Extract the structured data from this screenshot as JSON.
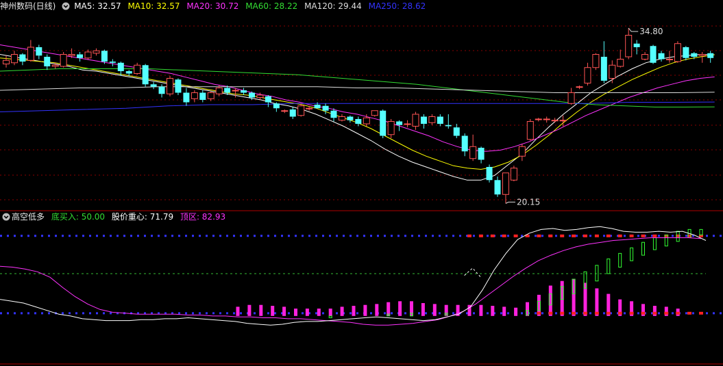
{
  "main_header": {
    "title": "神州数码(日线)",
    "icon": "circle-chevron-down-icon",
    "items": [
      {
        "text": "MA5: 32.57",
        "color": "#ffffff"
      },
      {
        "text": "MA10: 32.57",
        "color": "#ffff00"
      },
      {
        "text": "MA20: 30.72",
        "color": "#ff33ff"
      },
      {
        "text": "MA60: 28.22",
        "color": "#33dd33"
      },
      {
        "text": "MA120: 29.44",
        "color": "#dddddd"
      },
      {
        "text": "MA250: 28.62",
        "color": "#3333ff"
      }
    ]
  },
  "indicator_header": {
    "title": "高空低多",
    "icon": "circle-chevron-down-icon",
    "items": [
      {
        "text": "底买入: 50.00",
        "color": "#33dd33"
      },
      {
        "text": "股价重心: 71.79",
        "color": "#ffffff"
      },
      {
        "text": "顶区: 82.93",
        "color": "#ff33ff"
      }
    ]
  },
  "colors": {
    "up": "#ff5555",
    "down": "#55ffff",
    "grid": "#8b0000",
    "ma5": "#ffffff",
    "ma10": "#ffff00",
    "ma20": "#ff33ff",
    "ma60": "#33dd33",
    "ma120": "#dddddd",
    "ma250": "#3333ff"
  },
  "chart_data": [
    {
      "type": "candlestick",
      "title": "神州数码(日线)",
      "ylim": [
        20,
        36
      ],
      "high_label": "34.80",
      "low_label": "20.15",
      "candles": [
        [
          31.8,
          32.1,
          31.5,
          32.5
        ],
        [
          31.9,
          32.6,
          31.7,
          32.9
        ],
        [
          32.6,
          32.0,
          31.7,
          32.7
        ],
        [
          32.1,
          33.2,
          32.0,
          33.8
        ],
        [
          33.2,
          32.5,
          32.2,
          33.4
        ],
        [
          32.4,
          31.6,
          31.3,
          32.6
        ],
        [
          31.6,
          31.7,
          31.4,
          31.9
        ],
        [
          31.6,
          32.6,
          31.5,
          32.8
        ],
        [
          32.5,
          32.6,
          32.3,
          33.1
        ],
        [
          32.6,
          32.3,
          32.0,
          32.8
        ],
        [
          32.3,
          32.8,
          32.2,
          33.0
        ],
        [
          32.7,
          32.9,
          32.5,
          33.1
        ],
        [
          32.9,
          32.0,
          31.8,
          33.0
        ],
        [
          32.0,
          31.9,
          31.6,
          32.2
        ],
        [
          31.9,
          31.2,
          30.8,
          32.0
        ],
        [
          31.2,
          31.0,
          30.8,
          31.3
        ],
        [
          31.0,
          31.7,
          30.9,
          31.9
        ],
        [
          31.7,
          30.1,
          29.9,
          31.8
        ],
        [
          30.1,
          29.9,
          29.7,
          30.3
        ],
        [
          29.9,
          29.3,
          29.0,
          30.1
        ],
        [
          29.3,
          30.6,
          29.1,
          30.8
        ],
        [
          30.5,
          29.4,
          29.2,
          30.6
        ],
        [
          29.4,
          28.6,
          28.3,
          29.8
        ],
        [
          28.9,
          29.4,
          28.6,
          29.6
        ],
        [
          29.4,
          28.8,
          28.6,
          29.6
        ],
        [
          28.9,
          29.4,
          28.7,
          29.5
        ],
        [
          29.3,
          29.8,
          29.1,
          30.0
        ],
        [
          29.8,
          29.4,
          29.2,
          30.0
        ],
        [
          29.6,
          29.6,
          29.0,
          29.8
        ],
        [
          29.6,
          29.4,
          29.2,
          29.8
        ],
        [
          29.4,
          29.0,
          28.8,
          29.5
        ],
        [
          29.0,
          29.2,
          28.8,
          29.4
        ],
        [
          29.1,
          28.6,
          28.2,
          29.2
        ],
        [
          28.5,
          28.1,
          27.8,
          28.6
        ],
        [
          27.9,
          27.9,
          27.7,
          28.0
        ],
        [
          28.0,
          27.4,
          27.2,
          28.2
        ],
        [
          27.5,
          28.3,
          27.4,
          28.5
        ],
        [
          28.1,
          28.1,
          27.9,
          28.3
        ],
        [
          28.4,
          28.1,
          28.1,
          28.6
        ],
        [
          28.3,
          27.9,
          27.6,
          28.5
        ],
        [
          27.9,
          27.3,
          27.0,
          28.1
        ],
        [
          27.1,
          27.4,
          27.0,
          27.6
        ],
        [
          27.4,
          27.1,
          26.9,
          27.5
        ],
        [
          27.2,
          26.8,
          26.6,
          27.4
        ],
        [
          26.8,
          27.3,
          26.6,
          27.6
        ],
        [
          27.5,
          27.9,
          27.4,
          27.9
        ],
        [
          27.9,
          25.8,
          25.6,
          28.0
        ],
        [
          25.9,
          27.0,
          25.6,
          27.2
        ],
        [
          27.0,
          26.7,
          26.2,
          27.1
        ],
        [
          26.8,
          26.8,
          26.5,
          27.1
        ],
        [
          26.6,
          27.6,
          26.3,
          27.8
        ],
        [
          27.4,
          26.8,
          26.4,
          27.6
        ],
        [
          26.9,
          27.4,
          26.7,
          27.6
        ],
        [
          27.4,
          26.8,
          26.6,
          27.6
        ],
        [
          26.7,
          26.6,
          26.4,
          27.6
        ],
        [
          26.5,
          25.8,
          25.6,
          26.8
        ],
        [
          25.8,
          24.5,
          24.1,
          26.0
        ],
        [
          23.9,
          24.9,
          23.7,
          25.9
        ],
        [
          24.8,
          23.8,
          23.5,
          24.9
        ],
        [
          23.2,
          22.1,
          21.9,
          23.4
        ],
        [
          22.1,
          20.9,
          20.7,
          22.4
        ],
        [
          20.9,
          22.7,
          20.15,
          22.7
        ],
        [
          22.1,
          23.1,
          22.0,
          23.3
        ],
        [
          24.1,
          24.9,
          23.7,
          25.1
        ],
        [
          25.5,
          27.0,
          25.4,
          27.2
        ],
        [
          27.2,
          27.2,
          27.0,
          27.3
        ],
        [
          27.2,
          27.2,
          26.9,
          27.4
        ],
        [
          27.1,
          27.1,
          26.9,
          27.3
        ],
        [
          27.1,
          27.1,
          26.6,
          27.5
        ],
        [
          28.5,
          29.4,
          28.4,
          29.8
        ],
        [
          29.9,
          29.9,
          29.7,
          30.0
        ],
        [
          30.2,
          31.5,
          30.0,
          31.9
        ],
        [
          31.5,
          32.6,
          31.3,
          32.7
        ],
        [
          32.4,
          30.4,
          30.2,
          33.7
        ],
        [
          30.6,
          31.7,
          30.2,
          32.1
        ],
        [
          31.6,
          32.2,
          31.5,
          33.0
        ],
        [
          32.4,
          34.2,
          32.2,
          34.8
        ],
        [
          33.5,
          33.2,
          32.6,
          33.8
        ],
        [
          32.2,
          32.6,
          32.1,
          32.8
        ],
        [
          33.3,
          31.9,
          31.8,
          33.4
        ],
        [
          32.7,
          32.2,
          32.0,
          32.9
        ],
        [
          32.2,
          32.2,
          31.9,
          32.9
        ],
        [
          32.0,
          33.5,
          31.9,
          33.7
        ],
        [
          33.2,
          32.3,
          32.1,
          33.3
        ],
        [
          32.7,
          32.4,
          32.2,
          32.8
        ],
        [
          32.5,
          32.6,
          31.9,
          32.8
        ],
        [
          32.7,
          32.3,
          31.9,
          32.9
        ]
      ],
      "ma": {
        "ma5": [
          32.6,
          32.4,
          32.2,
          32.0,
          31.8,
          31.6,
          31.3,
          31.2,
          31.0,
          30.8,
          30.6,
          30.4,
          30.2,
          30.0,
          29.8,
          29.6,
          29.4,
          29.2,
          29.0,
          28.8,
          28.5,
          28.3,
          28.0,
          27.6,
          27.1,
          26.6,
          26.0,
          25.4,
          24.7,
          24.1,
          23.6,
          23.2,
          22.8,
          22.4,
          22.1,
          22.1,
          22.5,
          23.4,
          24.3,
          25.5,
          26.6,
          27.6,
          28.5,
          29.4,
          30.1,
          30.8,
          31.4,
          31.9,
          32.2,
          32.4,
          32.5,
          32.6,
          32.57
        ],
        "ma10": [
          32.3,
          32.2,
          32.1,
          32.0,
          31.9,
          31.7,
          31.5,
          31.3,
          31.1,
          30.9,
          30.7,
          30.5,
          30.3,
          30.1,
          29.9,
          29.7,
          29.5,
          29.3,
          29.2,
          29.0,
          28.8,
          28.6,
          28.4,
          28.1,
          27.7,
          27.3,
          26.9,
          26.4,
          25.8,
          25.2,
          24.6,
          24.1,
          23.7,
          23.3,
          23.1,
          23.0,
          23.2,
          23.6,
          24.2,
          25.0,
          25.9,
          26.9,
          27.8,
          28.6,
          29.3,
          29.9,
          30.5,
          31.0,
          31.5,
          31.9,
          32.2,
          32.4,
          32.57
        ],
        "ma20": [
          33.4,
          33.2,
          33.0,
          32.8,
          32.6,
          32.4,
          32.2,
          32.0,
          31.8,
          31.6,
          31.4,
          31.2,
          31.0,
          30.7,
          30.4,
          30.1,
          29.9,
          29.6,
          29.3,
          29.1,
          28.8,
          28.6,
          28.3,
          28.1,
          27.8,
          27.6,
          27.3,
          27.0,
          26.6,
          26.2,
          25.8,
          25.3,
          24.9,
          24.6,
          24.5,
          24.6,
          24.9,
          25.3,
          25.8,
          26.3,
          26.9,
          27.5,
          28.0,
          28.5,
          29.0,
          29.4,
          29.8,
          30.1,
          30.4,
          30.6,
          30.72
        ],
        "ma60": [
          31.2,
          31.3,
          31.4,
          31.4,
          31.4,
          31.4,
          31.3,
          31.2,
          31.1,
          31.0,
          30.9,
          30.7,
          30.5,
          30.3,
          30.1,
          29.8,
          29.5,
          29.2,
          28.9,
          28.6,
          28.4,
          28.3,
          28.2,
          28.2,
          28.22
        ],
        "ma120": [
          29.6,
          29.7,
          29.8,
          29.8,
          29.9,
          29.9,
          29.9,
          29.9,
          29.9,
          29.8,
          29.8,
          29.7,
          29.6,
          29.5,
          29.4,
          29.4,
          29.4,
          29.4,
          29.44
        ],
        "ma250": [
          27.8,
          27.9,
          28.0,
          28.1,
          28.3,
          28.4,
          28.4,
          28.5,
          28.5,
          28.5,
          28.5,
          28.5,
          28.5,
          28.5,
          28.5,
          28.6,
          28.6,
          28.62
        ]
      }
    },
    {
      "type": "mixed",
      "title": "高空低多",
      "ylim": [
        0,
        110
      ],
      "levels": {
        "bottom_buy": 50.0,
        "price_center": 71.79,
        "top_zone": 82.93
      },
      "level_line_guides": {
        "blue_dotted_upper": 99,
        "blue_dotted_lower": 15,
        "green_dashed": 58
      },
      "magenta_line": [
        66,
        65,
        63,
        60,
        54,
        43,
        33,
        25,
        19,
        16,
        15,
        14,
        14,
        14,
        14,
        13,
        13,
        12,
        12,
        11,
        11,
        10,
        10,
        9,
        9,
        8,
        7,
        6,
        5,
        3,
        2,
        2,
        3,
        4,
        6,
        8,
        12,
        17,
        25,
        35,
        45,
        55,
        64,
        72,
        78,
        83,
        87,
        90,
        92,
        94,
        95,
        96,
        97,
        97,
        97,
        97,
        96
      ],
      "white_line": [
        30,
        28,
        26,
        22,
        18,
        14,
        12,
        9,
        8,
        7,
        7,
        7,
        8,
        8,
        9,
        9,
        10,
        9,
        8,
        7,
        6,
        4,
        3,
        2,
        3,
        5,
        6,
        6,
        7,
        8,
        9,
        10,
        11,
        10,
        9,
        8,
        7,
        8,
        11,
        14,
        22,
        40,
        62,
        80,
        95,
        102,
        106,
        107,
        105,
        106,
        108,
        109,
        107,
        104,
        103,
        103,
        104,
        103,
        104,
        100,
        94
      ],
      "white_line_dashed_peak": [
        56,
        64
      ],
      "magenta_bars": [
        {
          "i": 20,
          "v": 22
        },
        {
          "i": 21,
          "v": 24
        },
        {
          "i": 22,
          "v": 24
        },
        {
          "i": 23,
          "v": 23
        },
        {
          "i": 24,
          "v": 22
        },
        {
          "i": 25,
          "v": 20
        },
        {
          "i": 26,
          "v": 20
        },
        {
          "i": 27,
          "v": 20
        },
        {
          "i": 28,
          "v": 20
        },
        {
          "i": 29,
          "v": 22
        },
        {
          "i": 30,
          "v": 23
        },
        {
          "i": 31,
          "v": 24
        },
        {
          "i": 32,
          "v": 25
        },
        {
          "i": 33,
          "v": 27
        },
        {
          "i": 34,
          "v": 28
        },
        {
          "i": 35,
          "v": 28
        },
        {
          "i": 36,
          "v": 26
        },
        {
          "i": 37,
          "v": 25
        },
        {
          "i": 38,
          "v": 24
        },
        {
          "i": 39,
          "v": 24
        },
        {
          "i": 40,
          "v": 24
        },
        {
          "i": 41,
          "v": 24
        },
        {
          "i": 42,
          "v": 23
        },
        {
          "i": 43,
          "v": 22
        },
        {
          "i": 44,
          "v": 21
        },
        {
          "i": 45,
          "v": 27
        },
        {
          "i": 46,
          "v": 35
        },
        {
          "i": 47,
          "v": 45
        },
        {
          "i": 48,
          "v": 50
        },
        {
          "i": 49,
          "v": 52
        },
        {
          "i": 50,
          "v": 48
        },
        {
          "i": 51,
          "v": 42
        },
        {
          "i": 52,
          "v": 36
        },
        {
          "i": 53,
          "v": 30
        },
        {
          "i": 54,
          "v": 28
        },
        {
          "i": 55,
          "v": 25
        },
        {
          "i": 56,
          "v": 23
        },
        {
          "i": 57,
          "v": 22
        },
        {
          "i": 58,
          "v": 20
        }
      ],
      "green_bars": [
        {
          "i": 28,
          "lo": 10,
          "hi": 12
        },
        {
          "i": 33,
          "lo": 12,
          "hi": 14
        },
        {
          "i": 35,
          "lo": 12,
          "hi": 15
        },
        {
          "i": 38,
          "lo": 13,
          "hi": 15
        },
        {
          "i": 45,
          "lo": 13,
          "hi": 18
        },
        {
          "i": 46,
          "lo": 18,
          "hi": 28
        },
        {
          "i": 47,
          "lo": 24,
          "hi": 36
        },
        {
          "i": 48,
          "lo": 30,
          "hi": 44
        },
        {
          "i": 49,
          "lo": 36,
          "hi": 52
        },
        {
          "i": 50,
          "lo": 42,
          "hi": 60
        },
        {
          "i": 51,
          "lo": 50,
          "hi": 67
        },
        {
          "i": 52,
          "lo": 58,
          "hi": 74
        },
        {
          "i": 53,
          "lo": 65,
          "hi": 80
        },
        {
          "i": 54,
          "lo": 72,
          "hi": 86
        },
        {
          "i": 55,
          "lo": 78,
          "hi": 92
        },
        {
          "i": 56,
          "lo": 84,
          "hi": 97
        },
        {
          "i": 57,
          "lo": 88,
          "hi": 100
        },
        {
          "i": 58,
          "lo": 93,
          "hi": 104
        },
        {
          "i": 59,
          "lo": 97,
          "hi": 106
        },
        {
          "i": 60,
          "lo": 100,
          "hi": 106
        }
      ]
    }
  ]
}
